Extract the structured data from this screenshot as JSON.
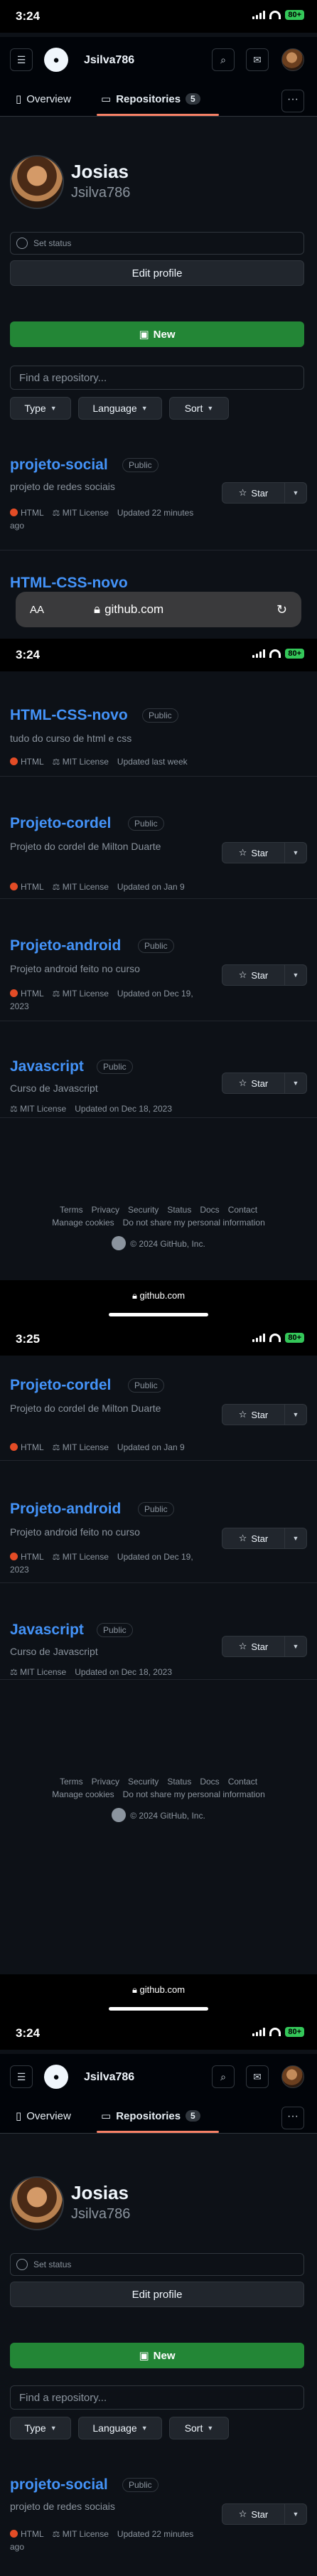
{
  "status_time_1": "3:24",
  "status_time_2": "3:24",
  "status_time_3": "3:25",
  "status_time_4": "3:24",
  "battery": "80+",
  "header": {
    "username": "Jsilva786"
  },
  "tabs": {
    "overview": "Overview",
    "repositories": "Repositories",
    "repo_count": "5"
  },
  "profile": {
    "name": "Josias",
    "username": "Jsilva786",
    "set_status": "Set status",
    "edit_profile": "Edit profile"
  },
  "new_button": "New",
  "search_placeholder": "Find a repository...",
  "filters": {
    "type": "Type",
    "language": "Language",
    "sort": "Sort"
  },
  "star_label": "Star",
  "public_label": "Public",
  "language": "HTML",
  "license": "MIT License",
  "repos": [
    {
      "name": "projeto-social",
      "desc": "projeto de redes sociais",
      "updated": "Updated 22 minutes ago"
    },
    {
      "name": "HTML-CSS-novo",
      "desc": "tudo do curso de html e css",
      "updated": "Updated last week"
    },
    {
      "name": "Projeto-cordel",
      "desc": "Projeto do cordel de Milton Duarte",
      "updated": "Updated on Jan 9"
    },
    {
      "name": "Projeto-android",
      "desc": "Projeto android feito no curso",
      "updated": "Updated on Dec 19, 2023"
    },
    {
      "name": "Javascript",
      "desc": "Curso de Javascript",
      "updated": "Updated on Dec 18, 2023"
    }
  ],
  "safari": {
    "aa": "AA",
    "url": "github.com"
  },
  "footer": {
    "row1": [
      "Terms",
      "Privacy",
      "Security",
      "Status",
      "Docs",
      "Contact"
    ],
    "row2": [
      "Manage cookies",
      "Do not share my personal information"
    ],
    "copyright": "© 2024 GitHub, Inc."
  },
  "bottom_url": "github.com"
}
